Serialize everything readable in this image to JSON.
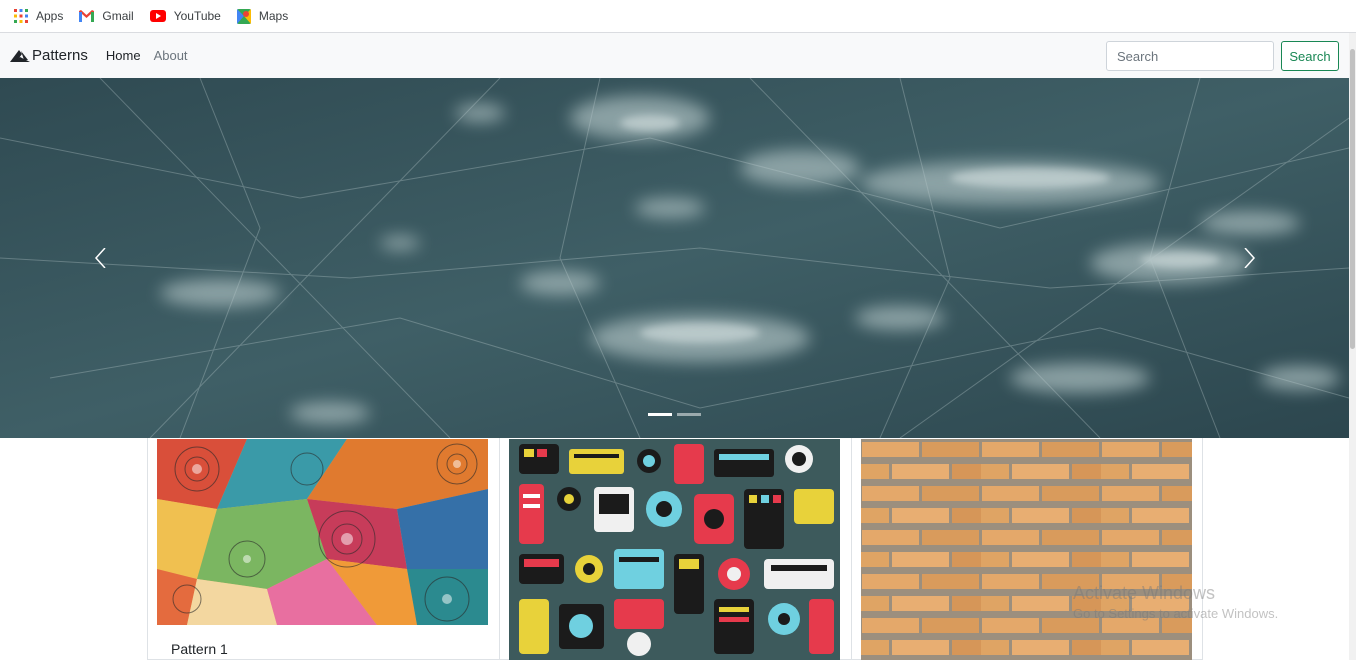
{
  "bookmarks": [
    {
      "label": "Apps",
      "icon": "apps-grid-icon"
    },
    {
      "label": "Gmail",
      "icon": "gmail-icon"
    },
    {
      "label": "YouTube",
      "icon": "youtube-icon"
    },
    {
      "label": "Maps",
      "icon": "maps-icon"
    }
  ],
  "navbar": {
    "brand": "Patterns",
    "links": [
      "Home",
      "About"
    ],
    "search_placeholder": "Search",
    "search_button": "Search"
  },
  "carousel": {
    "slide_count": 2,
    "active_slide": 1
  },
  "cards": [
    {
      "title": "Pattern 1"
    },
    {
      "title": ""
    },
    {
      "title": ""
    }
  ],
  "watermark": {
    "line1": "Activate Windows",
    "line2": "Go to Settings to activate Windows."
  },
  "colors": {
    "success": "#198754",
    "navbar_bg": "#f8f9fa"
  }
}
